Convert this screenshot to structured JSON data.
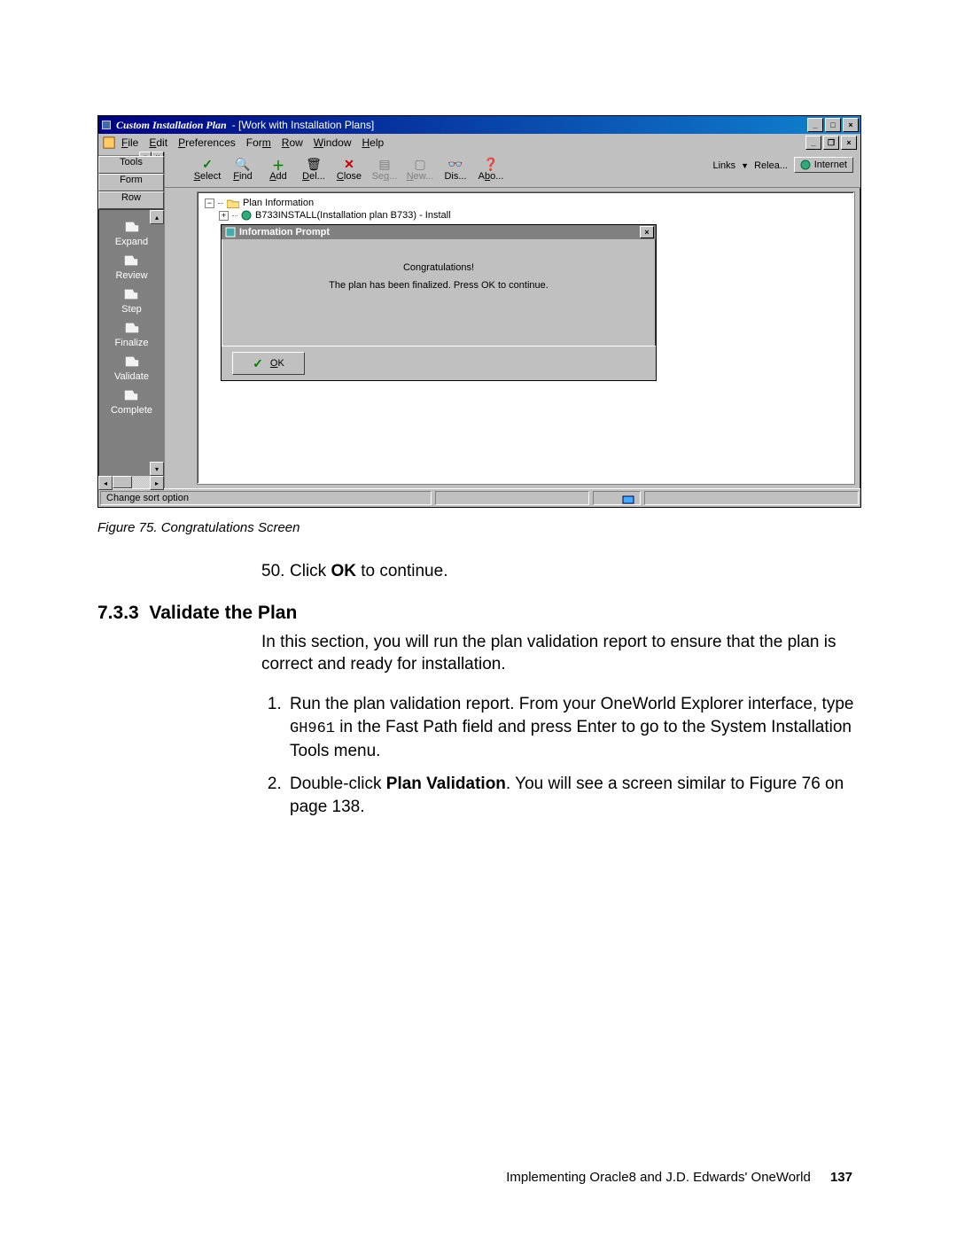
{
  "window": {
    "app_title": "Custom Installation Plan",
    "subtitle": "- [Work with Installation Plans]"
  },
  "menubar": {
    "file": "File",
    "edit": "Edit",
    "preferences": "Preferences",
    "form": "Form",
    "row": "Row",
    "window": "Window",
    "help": "Help"
  },
  "sidebar": {
    "tools": "Tools",
    "form": "Form",
    "row": "Row",
    "items": {
      "expand": "Expand",
      "review": "Review",
      "step": "Step",
      "finalize": "Finalize",
      "validate": "Validate",
      "complete": "Complete"
    }
  },
  "toolbar": {
    "select": "Select",
    "find": "Find",
    "add": "Add",
    "del": "Del...",
    "close": "Close",
    "seq": "Seq...",
    "new": "New...",
    "dis": "Dis...",
    "abo": "Abo...",
    "links": "Links",
    "relea": "Relea...",
    "internet": "Internet"
  },
  "tree": {
    "root": "Plan Information",
    "child": "B733INSTALL(Installation plan B733) - Install"
  },
  "dialog": {
    "title": "Information Prompt",
    "line1": "Congratulations!",
    "line2": "The plan has been finalized.  Press OK to continue.",
    "ok": "OK"
  },
  "status": {
    "text": "Change sort option"
  },
  "caption": "Figure 75.  Congratulations Screen",
  "body": {
    "step50_num": "50.",
    "step50_a": "Click ",
    "step50_b": "OK",
    "step50_c": " to continue."
  },
  "section": {
    "num": "7.3.3",
    "title": "Validate the Plan",
    "intro": "In this section, you will run the plan validation report to ensure that the plan is correct and ready for installation.",
    "li1a": "Run the plan validation report. From your OneWorld Explorer interface, type ",
    "li1code": "GH961",
    "li1b": " in the Fast Path field and press Enter to go to the System Installation Tools menu.",
    "li2a": "Double-click ",
    "li2b": "Plan Validation",
    "li2c": ". You will see a screen similar to Figure 76 on page 138."
  },
  "footer": {
    "text": "Implementing Oracle8 and J.D. Edwards' OneWorld",
    "page": "137"
  }
}
